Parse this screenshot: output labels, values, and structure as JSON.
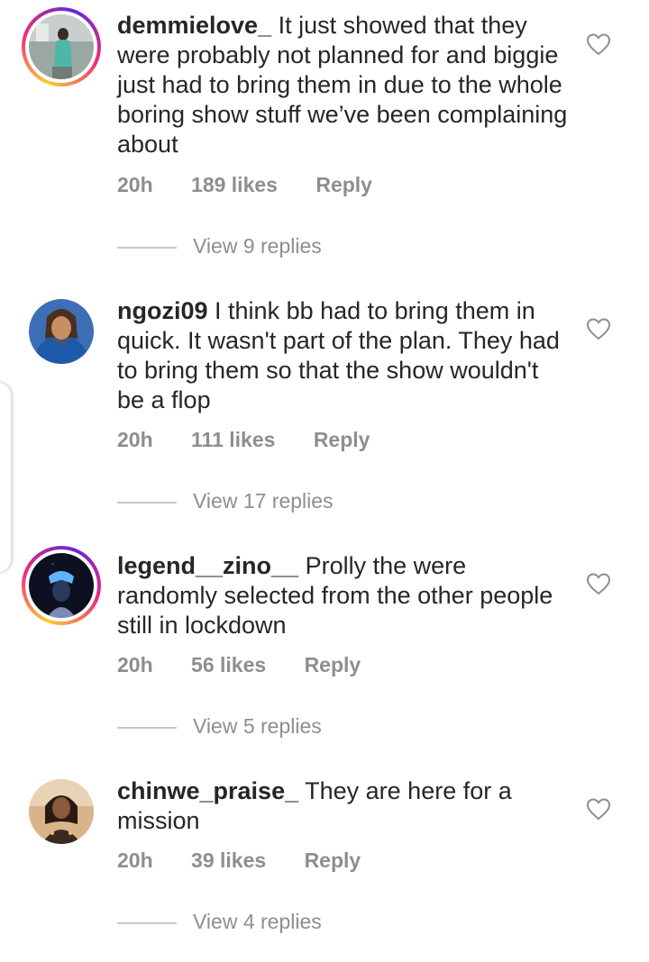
{
  "comments": [
    {
      "username": "demmielove_",
      "text": "It just showed that they were probably not planned for and biggie just had to bring them in due to the whole boring show stuff we’ve been complaining about",
      "time": "20h",
      "likes": "189 likes",
      "reply": "Reply",
      "view_replies": "View 9 replies"
    },
    {
      "username": "ngozi09",
      "text": "I think bb had to bring them in quick. It wasn't part of the plan. They had to bring them so that the show wouldn't be a flop",
      "time": "20h",
      "likes": "111 likes",
      "reply": "Reply",
      "view_replies": "View 17 replies"
    },
    {
      "username": "legend__zino__",
      "text": "Prolly the were randomly selected from the other people still in lockdown",
      "time": "20h",
      "likes": "56 likes",
      "reply": "Reply",
      "view_replies": "View 5 replies"
    },
    {
      "username": "chinwe_praise_",
      "text": "They are here for a mission",
      "time": "20h",
      "likes": "39 likes",
      "reply": "Reply",
      "view_replies": "View 4 replies"
    }
  ],
  "icons": {
    "like": "heart-outline-icon"
  },
  "colors": {
    "text": "#262626",
    "muted": "#8e8e8e",
    "divider": "#c7c7c7"
  }
}
